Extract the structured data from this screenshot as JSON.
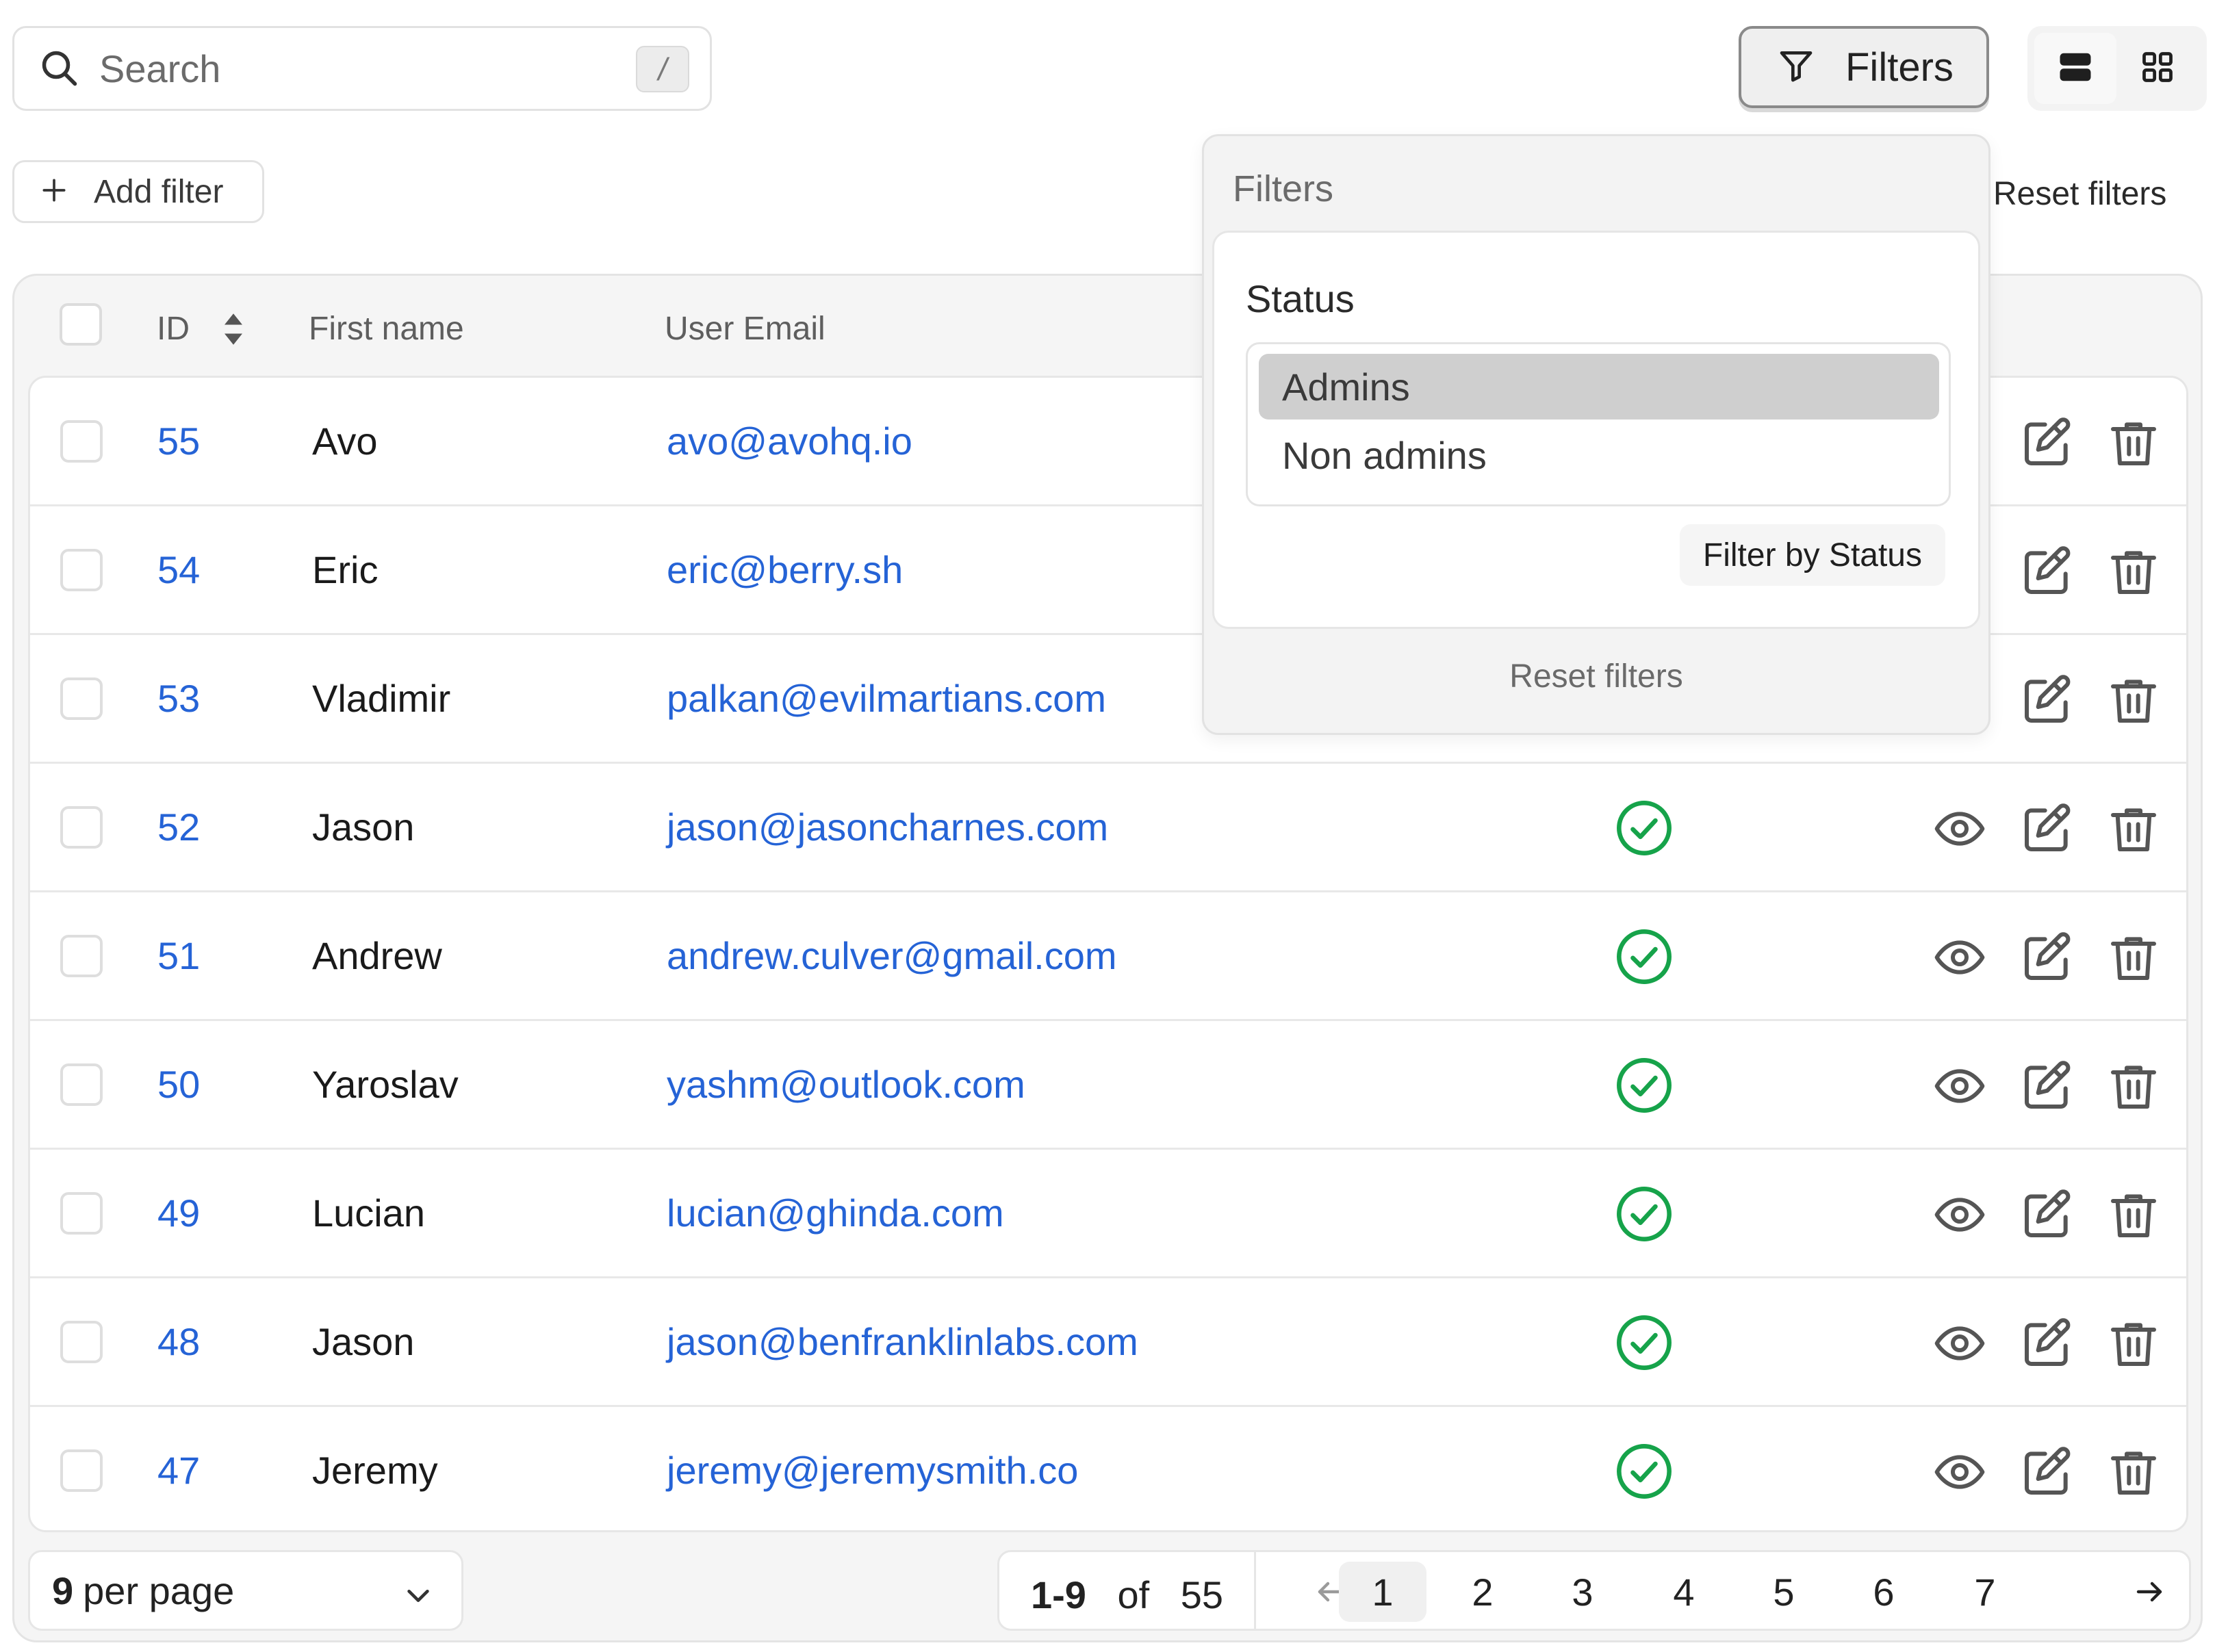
{
  "search": {
    "placeholder": "Search",
    "shortcut": "/"
  },
  "toolbar": {
    "filters_label": "Filters",
    "add_filter_label": "Add filter",
    "reset_filters_label": "Reset filters",
    "view_modes": [
      "table-view-icon",
      "grid-view-icon"
    ]
  },
  "table": {
    "columns": {
      "id": "ID",
      "first_name": "First name",
      "email": "User Email"
    },
    "rows": [
      {
        "id": "55",
        "first_name": "Avo",
        "email": "avo@avohq.io"
      },
      {
        "id": "54",
        "first_name": "Eric",
        "email": "eric@berry.sh"
      },
      {
        "id": "53",
        "first_name": "Vladimir",
        "email": "palkan@evilmartians.com"
      },
      {
        "id": "52",
        "first_name": "Jason",
        "email": "jason@jasoncharnes.com"
      },
      {
        "id": "51",
        "first_name": "Andrew",
        "email": "andrew.culver@gmail.com"
      },
      {
        "id": "50",
        "first_name": "Yaroslav",
        "email": "yashm@outlook.com"
      },
      {
        "id": "49",
        "first_name": "Lucian",
        "email": "lucian@ghinda.com"
      },
      {
        "id": "48",
        "first_name": "Jason",
        "email": "jason@benfranklinlabs.com"
      },
      {
        "id": "47",
        "first_name": "Jeremy",
        "email": "jeremy@jeremysmith.co"
      }
    ]
  },
  "footer": {
    "per_page_value": "9",
    "per_page_suffix": "per page",
    "range": "1-9",
    "of": "of",
    "total": "55",
    "pages": [
      "1",
      "2",
      "3",
      "4",
      "5",
      "6",
      "7"
    ],
    "current_page": "1"
  },
  "filters_dropdown": {
    "title": "Filters",
    "status_label": "Status",
    "options": [
      "Admins",
      "Non admins"
    ],
    "selected_option": "Admins",
    "apply_label": "Filter by Status",
    "reset_label": "Reset filters"
  },
  "colors": {
    "link": "#2563d6",
    "success": "#16a34a",
    "icon": "#555555"
  }
}
